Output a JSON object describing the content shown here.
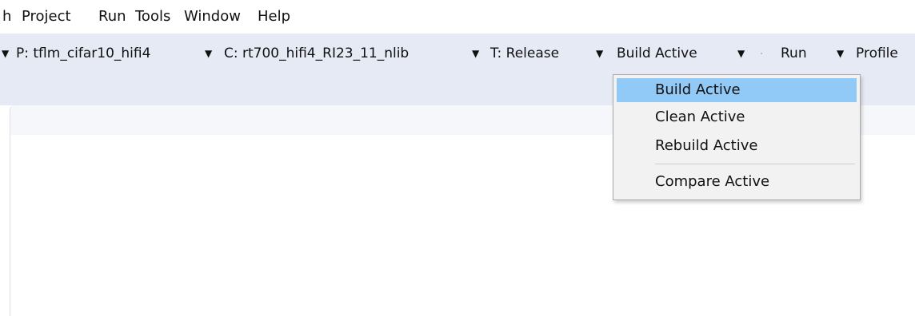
{
  "menubar": {
    "items": [
      {
        "label": "h"
      },
      {
        "label": "Project"
      },
      {
        "label": "Run"
      },
      {
        "label": "Tools"
      },
      {
        "label": "Window"
      },
      {
        "label": "Help"
      }
    ]
  },
  "toolbar": {
    "project": "P: tflm_cifar10_hifi4",
    "config": "C: rt700_hifi4_RI23_11_nlib",
    "target": "T: Release",
    "build": "Build Active",
    "separator": ".",
    "run": "Run",
    "profile": "Profile",
    "arrow_glyph": "▼"
  },
  "build_menu": {
    "items": [
      {
        "label": "Build Active",
        "selected": true
      },
      {
        "label": "Clean Active",
        "selected": false
      },
      {
        "label": "Rebuild Active",
        "selected": false
      },
      {
        "label": "Compare Active",
        "selected": false
      }
    ]
  },
  "colors": {
    "toolbar_bg": "#e6eaf5",
    "menu_highlight": "#91c9f7",
    "dropdown_bg": "#f2f2f2"
  }
}
